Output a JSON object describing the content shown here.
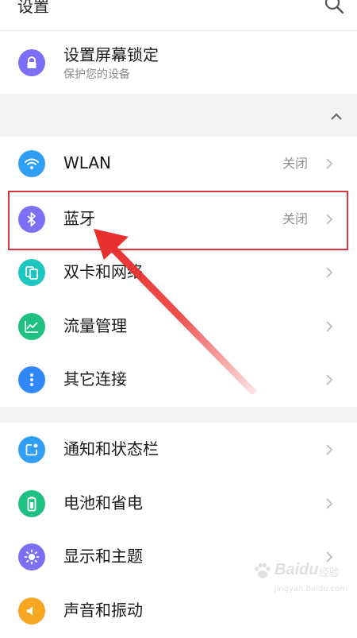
{
  "header": {
    "title": "设置",
    "search_icon": "search-icon"
  },
  "lock": {
    "title": "设置屏幕锁定",
    "subtitle": "保护您的设备",
    "icon": "lock-icon",
    "icon_color": "#7b6ff5"
  },
  "section_toggle_icon": "chevron-up-icon",
  "group1": [
    {
      "label": "WLAN",
      "status": "关闭",
      "icon": "wifi-icon",
      "color": "#2f9ff6"
    },
    {
      "label": "蓝牙",
      "status": "关闭",
      "icon": "bluetooth-icon",
      "color": "#7c6ff4"
    },
    {
      "label": "双卡和网络",
      "status": "",
      "icon": "dual-sim-icon",
      "color": "#1ec6c0"
    },
    {
      "label": "流量管理",
      "status": "",
      "icon": "data-usage-icon",
      "color": "#20c085"
    },
    {
      "label": "其它连接",
      "status": "",
      "icon": "more-connections-icon",
      "color": "#2f88f5"
    }
  ],
  "group2": [
    {
      "label": "通知和状态栏",
      "icon": "notification-icon",
      "color": "#2f9ff6"
    },
    {
      "label": "电池和省电",
      "icon": "battery-icon",
      "color": "#20c085"
    },
    {
      "label": "显示和主题",
      "icon": "brightness-icon",
      "color": "#7c6ff4"
    },
    {
      "label": "声音和振动",
      "icon": "sound-icon",
      "color": "#f5a623"
    }
  ],
  "annotation": {
    "highlight_color": "#d9363e",
    "arrow_color": "#e8302f"
  },
  "watermark": {
    "brand": "Baidu",
    "jy": "经验",
    "url": "jingyan.baidu.com"
  }
}
